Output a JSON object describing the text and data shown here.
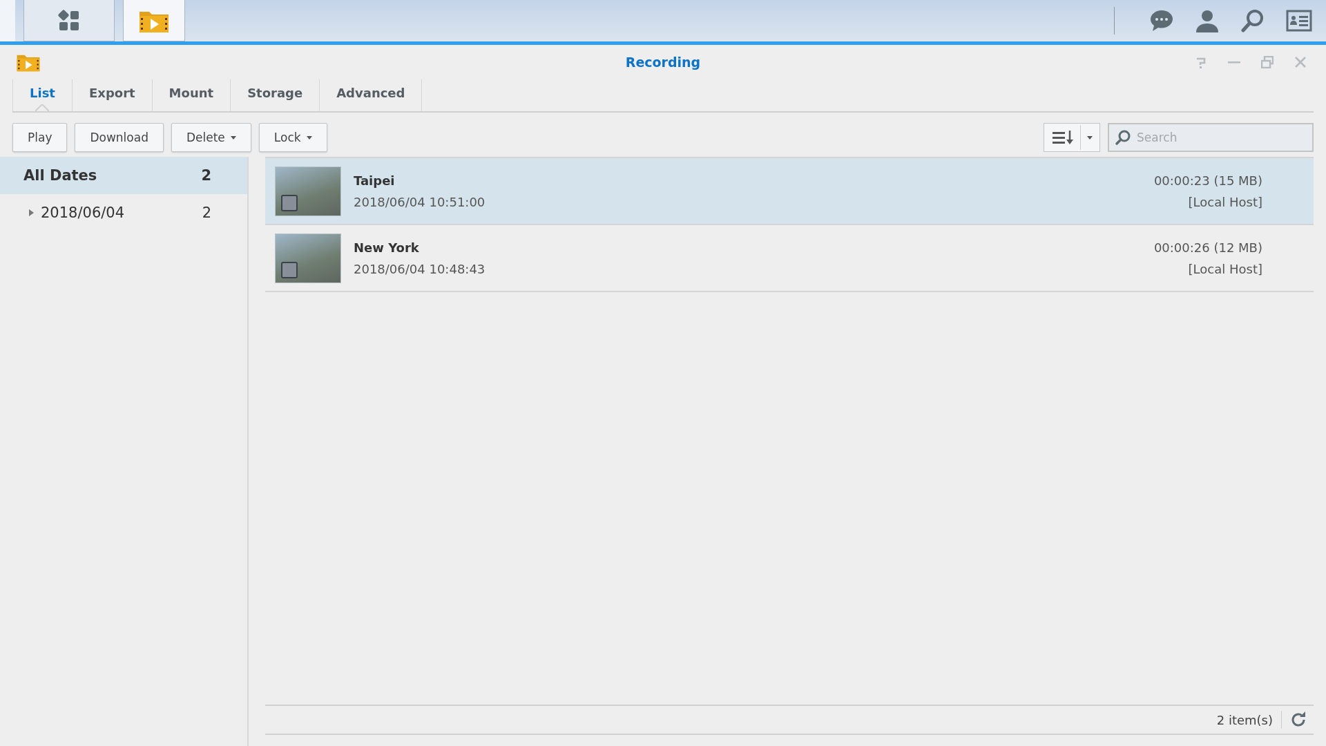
{
  "window": {
    "title": "Recording"
  },
  "tabs": [
    {
      "label": "List",
      "selected": true
    },
    {
      "label": "Export",
      "selected": false
    },
    {
      "label": "Mount",
      "selected": false
    },
    {
      "label": "Storage",
      "selected": false
    },
    {
      "label": "Advanced",
      "selected": false
    }
  ],
  "toolbar": {
    "buttons": [
      {
        "label": "Play",
        "dropdown": false
      },
      {
        "label": "Download",
        "dropdown": false
      },
      {
        "label": "Delete",
        "dropdown": true
      },
      {
        "label": "Lock",
        "dropdown": true
      }
    ],
    "search": {
      "placeholder": "Search"
    }
  },
  "sidebar": {
    "items": [
      {
        "label": "All Dates",
        "count": "2",
        "selected": true,
        "children": [
          {
            "label": "2018/06/04",
            "count": "2",
            "selected": false,
            "expanded": false
          }
        ]
      }
    ]
  },
  "recordings": [
    {
      "name": "Taipei",
      "time": "2018/06/04 10:51:00",
      "duration": "00:00:23 (15 MB)",
      "source": "[Local Host]",
      "selected": true
    },
    {
      "name": "New York",
      "time": "2018/06/04 10:48:43",
      "duration": "00:00:26 (12 MB)",
      "source": "[Local Host]",
      "selected": false
    }
  ],
  "status_bar": {
    "count": "2 item(s)"
  }
}
